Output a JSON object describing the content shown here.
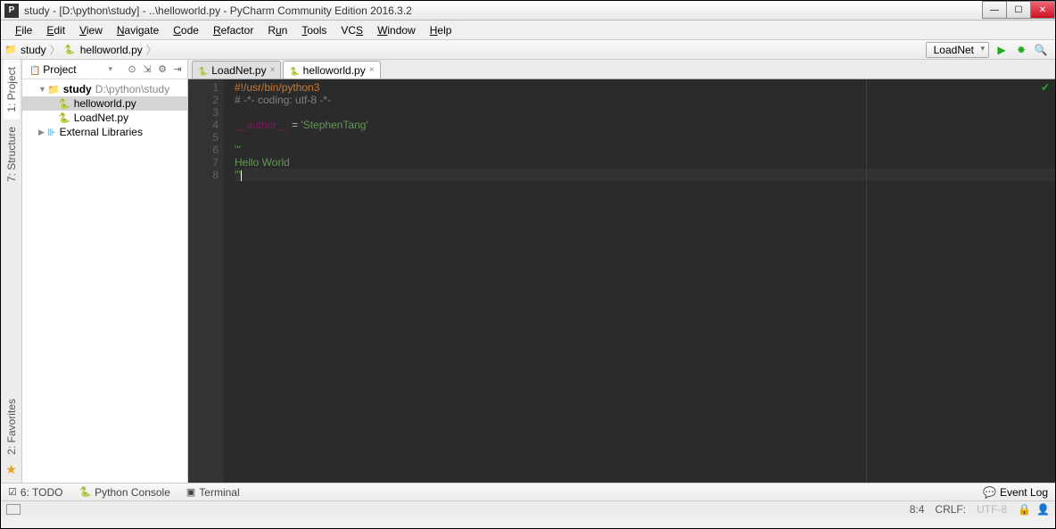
{
  "title": "study - [D:\\python\\study] - ..\\helloworld.py - PyCharm Community Edition 2016.3.2",
  "menu": [
    "File",
    "Edit",
    "View",
    "Navigate",
    "Code",
    "Refactor",
    "Run",
    "Tools",
    "VCS",
    "Window",
    "Help"
  ],
  "breadcrumb": {
    "root": "study",
    "file": "helloworld.py"
  },
  "runconfig": "LoadNet",
  "sidebar": {
    "project": "1: Project",
    "structure": "7: Structure",
    "favorites": "2: Favorites"
  },
  "panel": {
    "title": "Project",
    "root": "study",
    "rootpath": "D:\\python\\study",
    "files": [
      "helloworld.py",
      "LoadNet.py"
    ],
    "extlib": "External Libraries"
  },
  "tabs": [
    {
      "name": "LoadNet.py",
      "active": false
    },
    {
      "name": "helloworld.py",
      "active": true
    }
  ],
  "code": {
    "lines": [
      "1",
      "2",
      "3",
      "4",
      "5",
      "6",
      "7",
      "8"
    ],
    "l1": "#!/usr/bin/python3",
    "l2": "# -*- coding: utf-8 -*-",
    "l3": "",
    "l4a": "__author__",
    "l4b": " = ",
    "l4c": "'StephenTang'",
    "l5": "",
    "l6": "'''",
    "l7": "Hello World",
    "l8": "'''"
  },
  "tools": {
    "todo": "6: TODO",
    "console": "Python Console",
    "terminal": "Terminal",
    "eventlog": "Event Log"
  },
  "status": {
    "pos": "8:4",
    "sep": "CRLF:",
    "enc": "UTF-8"
  }
}
